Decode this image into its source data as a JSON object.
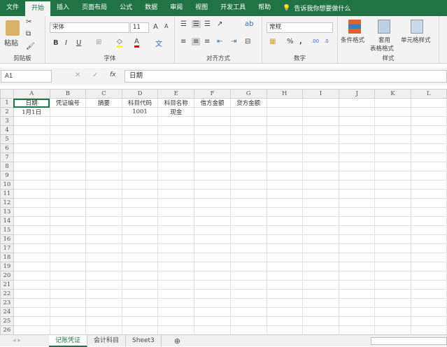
{
  "ribbon_tabs": [
    "文件",
    "开始",
    "插入",
    "页面布局",
    "公式",
    "数据",
    "审阅",
    "视图",
    "开发工具",
    "帮助"
  ],
  "active_tab": "开始",
  "tell_me": "告诉我你想要做什么",
  "clipboard": {
    "paste": "粘贴",
    "label": "剪贴板"
  },
  "font": {
    "name": "宋体",
    "size": "11",
    "label": "字体",
    "bold": "B",
    "italic": "I",
    "underline": "U",
    "grow": "A",
    "shrink": "A",
    "fill_color": "#ffff00",
    "font_color": "#e00000"
  },
  "alignment": {
    "label": "对齐方式"
  },
  "number": {
    "format": "常规",
    "label": "数字",
    "percent": "%",
    "comma": ","
  },
  "styles": {
    "conditional": "条件格式",
    "table_format_1": "套用",
    "table_format_2": "表格格式",
    "cell_styles": "单元格样式",
    "label": "样式"
  },
  "formula_bar": {
    "name_box": "A1",
    "fx": "fx",
    "value": "日期"
  },
  "columns": [
    "A",
    "B",
    "C",
    "D",
    "E",
    "F",
    "G",
    "H",
    "I",
    "J",
    "K",
    "L"
  ],
  "rows": [
    [
      "日期",
      "凭证编号",
      "摘要",
      "科目代码",
      "科目名称",
      "借方金额",
      "贷方金额",
      "",
      "",
      "",
      "",
      ""
    ],
    [
      "1月1日",
      "",
      "",
      "1001",
      "现金",
      "",
      "",
      "",
      "",
      "",
      "",
      ""
    ]
  ],
  "row_count": 26,
  "sheets": [
    "记账凭证",
    "会计科目",
    "Sheet3"
  ],
  "active_sheet": "记账凭证"
}
